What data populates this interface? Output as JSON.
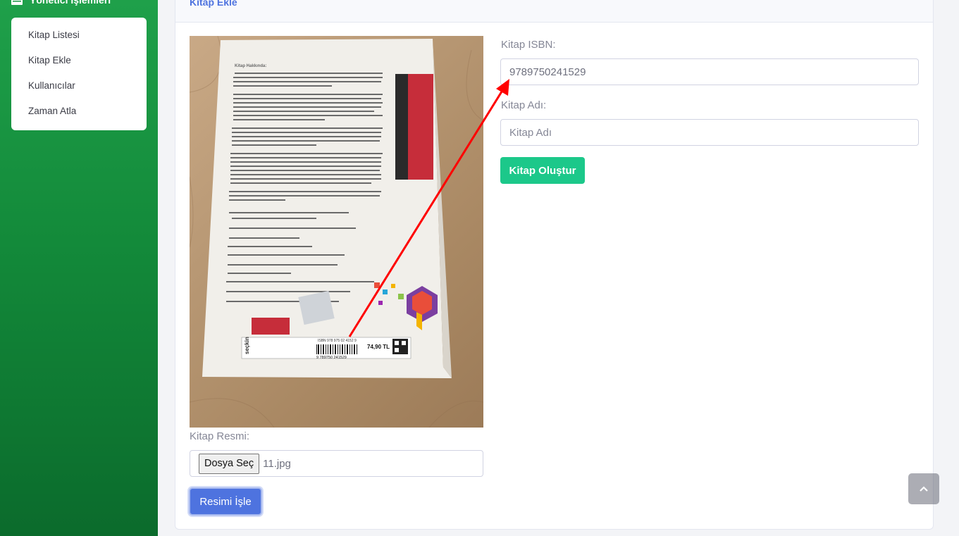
{
  "sidebar": {
    "heading": "Yönetici İşlemleri",
    "heading_icon": "table-icon",
    "items": [
      {
        "label": "Kitap Listesi"
      },
      {
        "label": "Kitap Ekle"
      },
      {
        "label": "Kullanıcılar"
      },
      {
        "label": "Zaman Atla"
      }
    ]
  },
  "card": {
    "title": "Kitap Ekle"
  },
  "form": {
    "isbn_label": "Kitap ISBN:",
    "isbn_value": "9789750241529",
    "name_label": "Kitap Adı:",
    "name_placeholder": "Kitap Adı",
    "create_button": "Kitap Oluştur",
    "image_label": "Kitap Resmi:",
    "file_button": "Dosya Seç",
    "file_name": "11.jpg",
    "process_button": "Resimi İşle"
  },
  "book_photo": {
    "heading": "Kitap Hakkında:",
    "price": "74,90 TL",
    "isbn_text": "ISBN 978 975 02 4152 9",
    "barcode_number": "9 789750 241529",
    "publisher": "seçkin"
  },
  "colors": {
    "sidebar": "#1a9644",
    "primary": "#4e73df",
    "success": "#1cc88a",
    "annotation_arrow": "#ff0000"
  },
  "scroll_top_icon": "chevron-up-icon"
}
